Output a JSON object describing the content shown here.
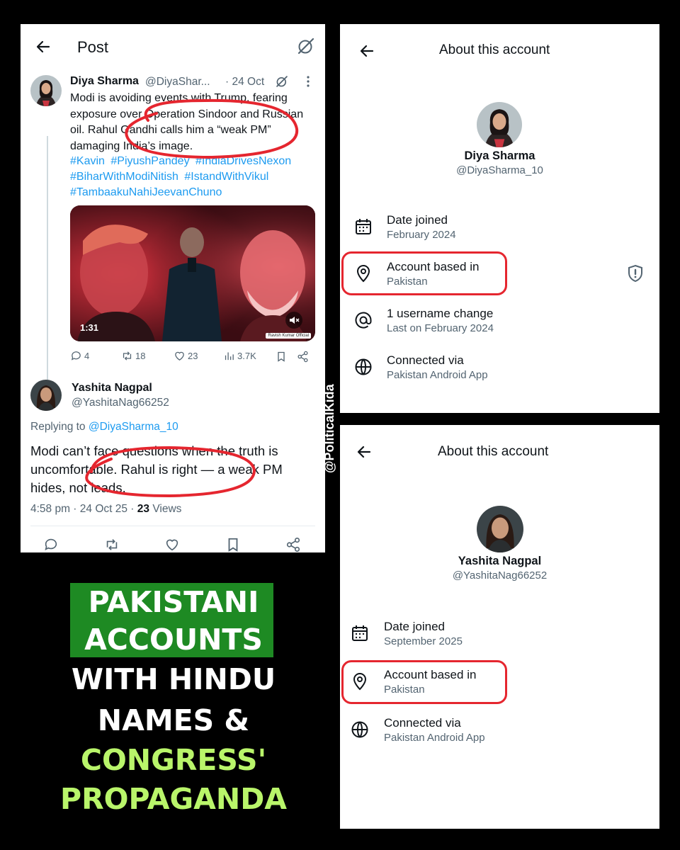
{
  "post": {
    "title": "Post",
    "tweet1": {
      "name": "Diya Sharma",
      "handle": "@DiyaShar...",
      "time": "· 24 Oct",
      "text": "Modi is avoiding events with Trump, fearing exposure over Operation Sindoor and Russian oil. Rahul Gandhi calls him a “weak PM” damaging India’s image.",
      "hashtags": [
        "#Kavin",
        "#PiyushPandey",
        "#IndiaDrivesNexon",
        "#BiharWithModiNitish",
        "#IstandWithVikul",
        "#TambaakuNahiJeevanChuno"
      ],
      "video_duration": "1:31",
      "video_credit": "Ravish Kumar Official",
      "replies": "4",
      "reposts": "18",
      "likes": "23",
      "views": "3.7K"
    },
    "tweet2": {
      "name": "Yashita Nagpal",
      "handle": "@YashitaNag66252",
      "replying_prefix": "Replying to",
      "replying_to": "@DiyaSharma_10",
      "text": "Modi can’t face questions when the truth is uncomfortable. Rahul is right — a weak PM hides, not leads.",
      "time": "4:58 pm · 24 Oct 25 · ",
      "views_count": "23",
      "views_label": " Views"
    }
  },
  "about1": {
    "title": "About this account",
    "name": "Diya Sharma",
    "handle": "@DiyaSharma_10",
    "rows": [
      {
        "label": "Date joined",
        "value": "February 2024",
        "icon": "calendar-icon"
      },
      {
        "label": "Account based in",
        "value": "Pakistan",
        "icon": "location-pin-icon"
      },
      {
        "label": "1 username change",
        "value": "Last on February 2024",
        "icon": "at-sign-icon"
      },
      {
        "label": "Connected via",
        "value": "Pakistan Android App",
        "icon": "globe-icon"
      }
    ]
  },
  "about2": {
    "title": "About this account",
    "name": "Yashita Nagpal",
    "handle": "@YashitaNag66252",
    "rows": [
      {
        "label": "Date joined",
        "value": "September 2025",
        "icon": "calendar-icon"
      },
      {
        "label": "Account based in",
        "value": "Pakistan",
        "icon": "location-pin-icon"
      },
      {
        "label": "Connected via",
        "value": "Pakistan Android App",
        "icon": "globe-icon"
      }
    ]
  },
  "caption": {
    "line1": "PAKISTANI",
    "line2": "ACCOUNTS",
    "line3": "WITH HINDU",
    "line4": "NAMES &",
    "line5": "CONGRESS'",
    "line6": "PROPAGANDA"
  },
  "watermark": "@PoliticalKida",
  "colors": {
    "accent_blue": "#1d9bf0",
    "highlight_red": "#e5262f",
    "caption_green": "#1e8a23",
    "caption_lime": "#b9f56a"
  }
}
